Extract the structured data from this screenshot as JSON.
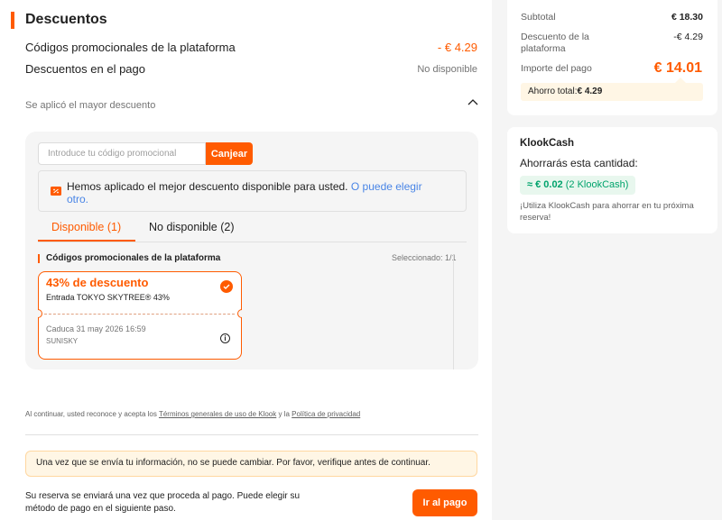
{
  "discounts": {
    "title": "Descuentos",
    "platform_codes_label": "Códigos promocionales de la plataforma",
    "platform_codes_value": "- € 4.29",
    "payment_discounts_label": "Descuentos en el pago",
    "payment_discounts_value": "No disponible",
    "applied_note": "Se aplicó el mayor descuento"
  },
  "promo": {
    "input_placeholder": "Introduce tu código promocional",
    "redeem_label": "Canjear",
    "notice_text": "Hemos aplicado el mejor descuento disponible para usted.",
    "notice_link": "O puede elegir otro."
  },
  "tabs": [
    {
      "label": "Disponible (1)",
      "active": true
    },
    {
      "label": "No disponible (2)",
      "active": false
    }
  ],
  "coupon_list": {
    "title": "Códigos promocionales de la plataforma",
    "selected": "Seleccionado: 1/1"
  },
  "coupon": {
    "title": "43% de descuento",
    "description": "Entrada TOKYO SKYTREE® 43%",
    "expires": "Caduca 31 may 2026 16:59",
    "code": "SUNISKY",
    "checked": true,
    "check_icon": "check-icon",
    "info_icon": "info-icon"
  },
  "terms": {
    "prefix": "Al continuar, usted reconoce y acepta los",
    "terms_link": "Términos generales de uso de Klook",
    "and": "y la",
    "privacy_link": "Política de privacidad"
  },
  "warning": "Una vez que se envía tu información, no se puede cambiar. Por favor, verifique antes de continuar.",
  "bottom_note": "Su reserva se enviará una vez que proceda al pago. Puede elegir su método de pago en el siguiente paso.",
  "pay_button": "Ir al pago",
  "summary": {
    "subtotal_label": "Subtotal",
    "subtotal_value": "€ 18.30",
    "discount_label": "Descuento de la plataforma",
    "discount_value": "-€ 4.29",
    "total_label": "Importe del pago",
    "total_value": "€ 14.01",
    "savings_label": "Ahorro total:",
    "savings_value": "€ 4.29"
  },
  "klookcash": {
    "title": "KlookCash",
    "subtitle": "Ahorrarás esta cantidad:",
    "amount": "≈ € 0.02",
    "amount_note": "(2 KlookCash)",
    "note": "¡Utiliza KlookCash para ahorrar en tu próxima reserva!"
  },
  "colors": {
    "accent": "#ff5b00",
    "link": "#4985e6",
    "success": "#00a36c"
  }
}
